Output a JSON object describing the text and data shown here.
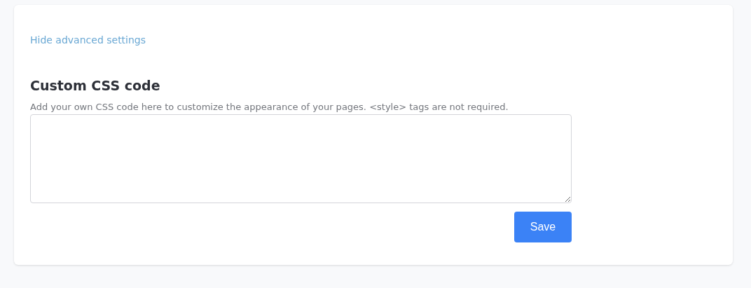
{
  "toggle_link": "Hide advanced settings",
  "section": {
    "title": "Custom CSS code",
    "description": "Add your own CSS code here to customize the appearance of your pages. <style> tags are not required."
  },
  "buttons": [
    "Save"
  ]
}
